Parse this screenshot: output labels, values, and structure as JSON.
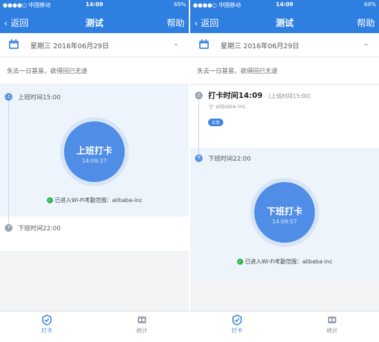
{
  "left": {
    "status": {
      "carrier": "●●●●○ 中国移动",
      "time": "14:09",
      "battery": "69%"
    },
    "nav": {
      "back": "返回",
      "title": "测试",
      "help": "帮助"
    },
    "date": "星期三 2016年06月29日",
    "motto": "失去一日甚易，欲得回已无途",
    "start_label": "上班时间15:00",
    "circle_title": "上班打卡",
    "circle_time": "14:09:37",
    "wifi_note": "已进入Wi-Fi考勤范围：alibaba-inc",
    "end_label": "下班时间22:00",
    "tabs": [
      {
        "label": "打卡"
      },
      {
        "label": "统计"
      }
    ]
  },
  "right": {
    "status": {
      "carrier": "●●●●○ 中国移动",
      "time": "14:09",
      "battery": "69%"
    },
    "nav": {
      "back": "返回",
      "title": "测试",
      "help": "帮助"
    },
    "date": "星期三 2016年06月29日",
    "motto": "失去一日甚易，欲得回已无途",
    "punch_title": "打卡时间14:09",
    "punch_sub": "（上班时间15:00）",
    "punch_loc": "alibaba-inc",
    "badge": "正常",
    "end_label": "下班时间22:00",
    "circle_title": "下班打卡",
    "circle_time": "14:09:57",
    "wifi_note": "已进入Wi-Fi考勤范围：alibaba-inc",
    "tabs": [
      {
        "label": "打卡"
      },
      {
        "label": "统计"
      }
    ]
  },
  "colors": {
    "brand": "#2f7fe0",
    "circle": "#4f8de6",
    "check": "#2eb94a"
  }
}
